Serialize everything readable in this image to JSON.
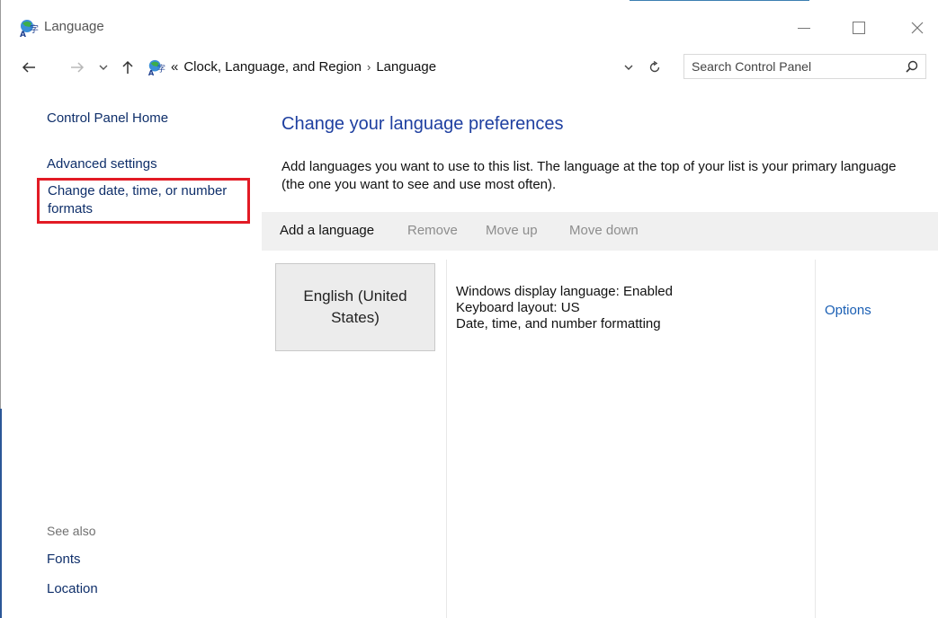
{
  "window": {
    "title": "Language",
    "controls": {
      "minimize": "minimize",
      "maximize": "maximize",
      "close": "close"
    }
  },
  "address_bar": {
    "overflow": "«",
    "crumbs": [
      "Clock, Language, and Region",
      "Language"
    ],
    "separator": "›"
  },
  "search": {
    "placeholder": "Search Control Panel"
  },
  "sidebar": {
    "home": "Control Panel Home",
    "advanced": "Advanced settings",
    "date_formats": "Change date, time, or number formats",
    "see_also": "See also",
    "fonts": "Fonts",
    "location": "Location"
  },
  "main": {
    "title": "Change your language preferences",
    "description": "Add languages you want to use to this list. The language at the top of your list is your primary language (the one you want to see and use most often)."
  },
  "toolbar": {
    "add": "Add a language",
    "remove": "Remove",
    "move_up": "Move up",
    "move_down": "Move down"
  },
  "languages": [
    {
      "name": "English (United States)",
      "details": [
        "Windows display language: Enabled",
        "Keyboard layout: US",
        "Date, time, and number formatting"
      ],
      "options": "Options"
    }
  ],
  "colors": {
    "link": "#0f2f6a",
    "title_blue": "#1e3fa0",
    "highlight": "#e21b25",
    "disabled": "#8d8d8d"
  }
}
